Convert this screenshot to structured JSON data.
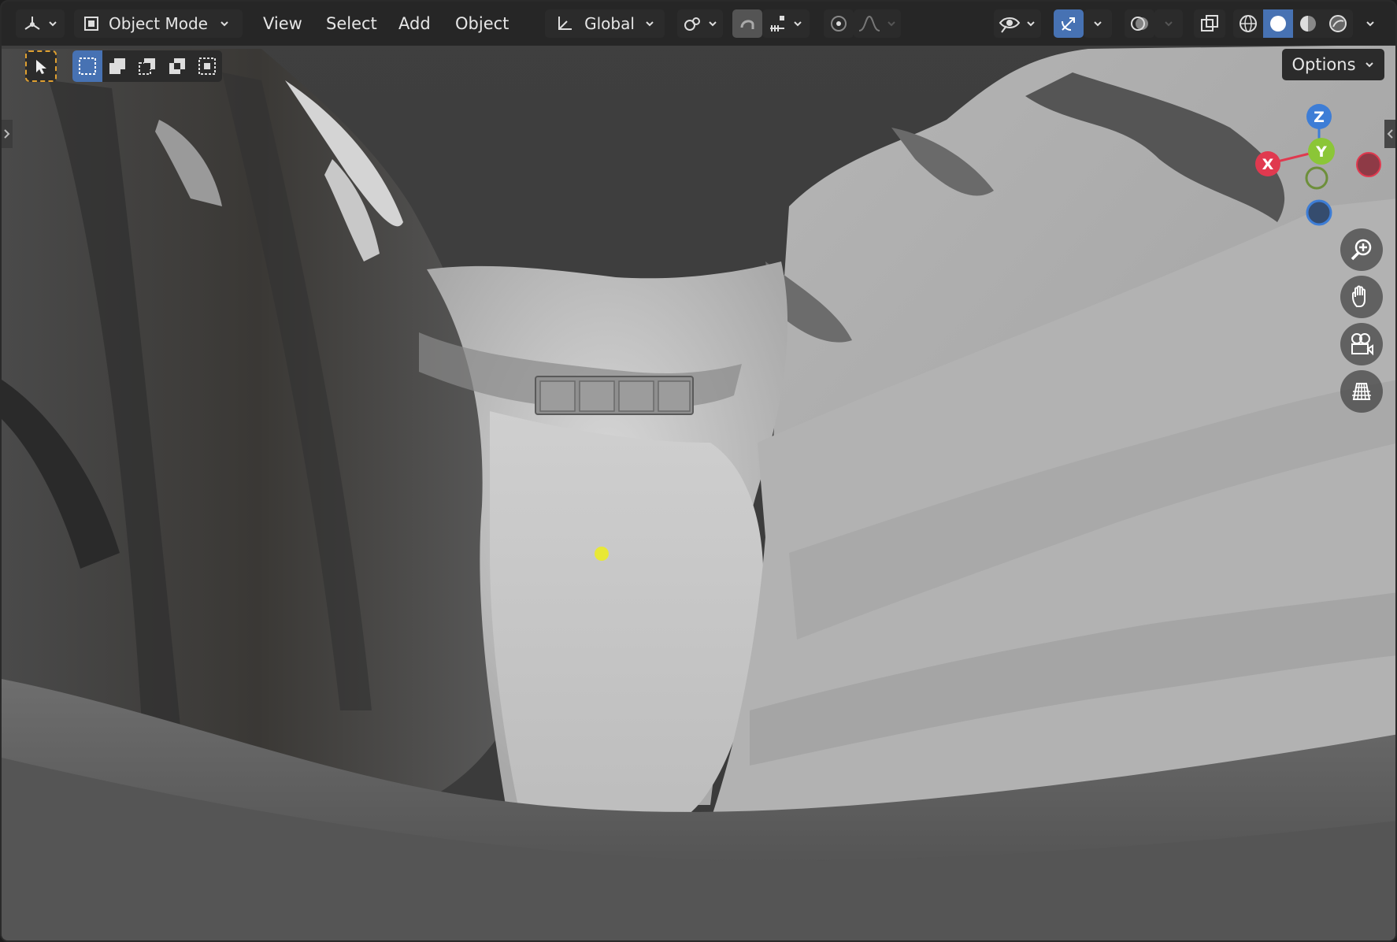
{
  "header": {
    "editor_type_icon": "3d-viewport-icon",
    "mode_label": "Object Mode",
    "menus": [
      "View",
      "Select",
      "Add",
      "Object"
    ],
    "transform_orientation": "Global",
    "pivot_icon": "pivot-point-icon",
    "snap_icon": "magnet-snap-icon",
    "snap_target_icon": "snap-increment-icon",
    "proportional_icon": "proportional-edit-icon",
    "falloff_icon": "falloff-curve-icon",
    "visibility_icon": "eye-visibility-icon",
    "gizmo_icon": "gizmo-icon",
    "overlay_icon": "overlay-icon",
    "xray_icon": "xray-icon",
    "shading_modes": [
      "wireframe",
      "solid",
      "material-preview",
      "rendered"
    ],
    "active_shading": "solid"
  },
  "toolbar": {
    "select_tool_icon": "select-cursor-icon",
    "selection_modes": [
      "set",
      "extend",
      "subtract",
      "invert",
      "intersect"
    ],
    "active_selection_mode": "set",
    "options_label": "Options"
  },
  "gizmo": {
    "axes": {
      "x": "X",
      "y": "Y",
      "z": "Z"
    },
    "colors": {
      "x": "#e0394f",
      "y": "#8bc637",
      "z": "#3d7dd6"
    }
  },
  "navigation": [
    "zoom-icon",
    "pan-hand-icon",
    "camera-view-icon",
    "ortho-grid-icon"
  ],
  "colors": {
    "accent": "#4772b3",
    "header_bg": "#242424",
    "light": "#e8e836"
  }
}
